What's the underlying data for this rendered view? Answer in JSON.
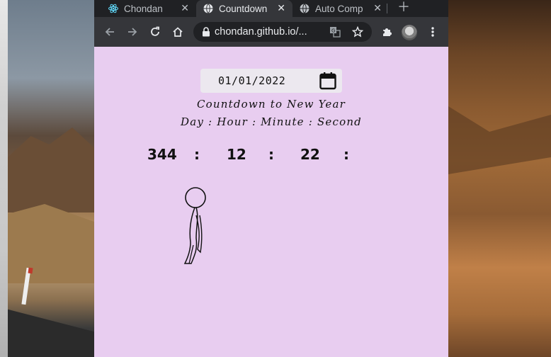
{
  "browser": {
    "tabs": [
      {
        "title": "Chondan",
        "icon": "react-icon",
        "active": false
      },
      {
        "title": "Countdown",
        "icon": "globe-icon",
        "active": true
      },
      {
        "title": "Auto Comp",
        "icon": "globe-icon",
        "active": false
      }
    ],
    "url": "chondan.github.io/..."
  },
  "page": {
    "date_value": "01/01/2022",
    "title": "Countdown to New Year",
    "labels": "Day : Hour : Minute : Second",
    "countdown": {
      "day": "344",
      "hour": "12",
      "minute": "22",
      "separator": ":"
    }
  },
  "colors": {
    "page_bg": "#e8cdf0",
    "tab_bar": "#202124",
    "toolbar": "#35363a"
  }
}
